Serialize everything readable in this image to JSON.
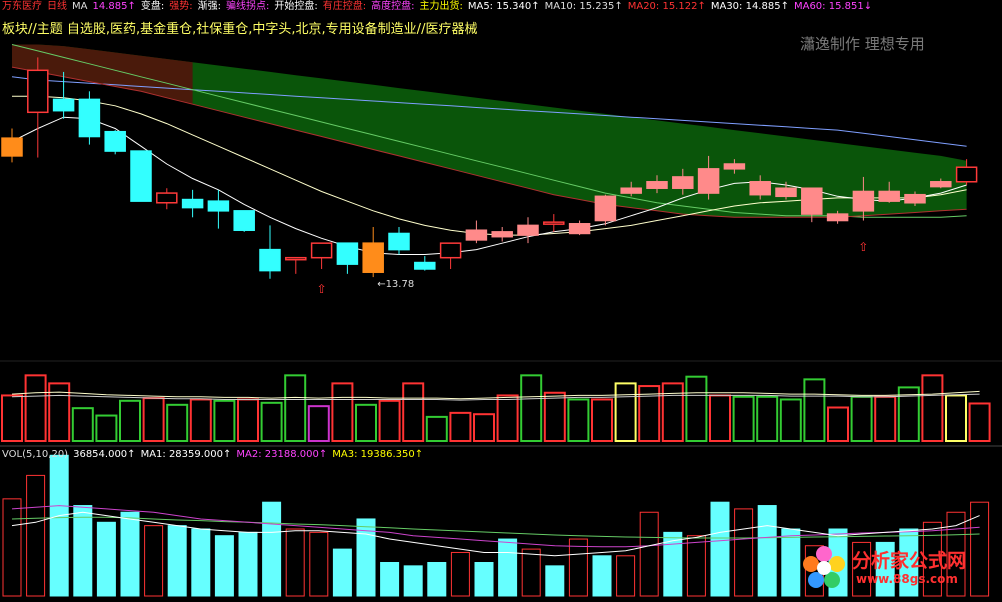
{
  "header": {
    "items": [
      {
        "text": "万东医疗",
        "color": "#ff3333"
      },
      {
        "text": "日线",
        "color": "#ff3333"
      },
      {
        "text": "MA",
        "color": "#dddddd"
      },
      {
        "text": "14.885↑",
        "color": "#ff44ff"
      },
      {
        "text": "变盘:",
        "color": "#ffffff"
      },
      {
        "text": "强势:",
        "color": "#ff3333"
      },
      {
        "text": "渐强:",
        "color": "#ffffff"
      },
      {
        "text": "骗线拐点:",
        "color": "#ff44ff"
      },
      {
        "text": "开始控盘:",
        "color": "#ffffff"
      },
      {
        "text": "有庄控盘:",
        "color": "#ff3333"
      },
      {
        "text": "高度控盘:",
        "color": "#ff44ff"
      },
      {
        "text": "主力出货:",
        "color": "#ffff00"
      },
      {
        "text": "MA5: 15.340↑",
        "color": "#ffffff"
      },
      {
        "text": "MA10: 15.235↑",
        "color": "#dddddd"
      },
      {
        "text": "MA20: 15.122↑",
        "color": "#ff3333"
      },
      {
        "text": "MA30: 14.885↑",
        "color": "#ffffff"
      },
      {
        "text": "MA60: 15.851↓",
        "color": "#ff44ff"
      }
    ],
    "block_text": "板块//主题 自选股,医药,基金重仓,社保重仓,中字头,北京,专用设备制造业//医疗器械"
  },
  "watermark": "瀟逸制作 理想专用",
  "volume_header": {
    "items": [
      {
        "text": "VOL(5,10,20)",
        "color": "#dddddd"
      },
      {
        "text": "36854.000↑",
        "color": "#ffffff"
      },
      {
        "text": "MA1: 28359.000↑",
        "color": "#ffffff"
      },
      {
        "text": "MA2: 23188.000↑",
        "color": "#ff44ff"
      },
      {
        "text": "MA3: 19386.350↑",
        "color": "#ffff00"
      }
    ]
  },
  "logo": {
    "title": "分析家公式网",
    "url": "www.88gs.com"
  },
  "colors": {
    "up": "#ff3a3a",
    "up_fill": "#ff8a8a",
    "down": "#33ffff",
    "ma5": "#ffffff",
    "ma10": "#ffffcc",
    "ma20": "#b03030",
    "ma30": "#66cc66",
    "ma60": "#7f9fff",
    "band": "#0b5a0b",
    "band_red": "#5a0b0b",
    "orange": "#ff8c1a"
  },
  "chart_data": [
    {
      "type": "candlestick",
      "title": "万东医疗 日线",
      "ylim": [
        12.6,
        20.4
      ],
      "low_label": "13.78",
      "candles": [
        {
          "o": 16.75,
          "c": 17.3,
          "h": 17.6,
          "l": 16.55,
          "k": "orange"
        },
        {
          "o": 18.1,
          "c": 19.4,
          "h": 19.8,
          "l": 16.7,
          "k": "up"
        },
        {
          "o": 18.5,
          "c": 18.15,
          "h": 19.35,
          "l": 17.9,
          "k": "down"
        },
        {
          "o": 18.5,
          "c": 17.35,
          "h": 18.75,
          "l": 17.1,
          "k": "down"
        },
        {
          "o": 17.5,
          "c": 16.9,
          "h": 17.55,
          "l": 16.8,
          "k": "down"
        },
        {
          "o": 16.9,
          "c": 15.35,
          "h": 16.9,
          "l": 15.35,
          "k": "down"
        },
        {
          "o": 15.3,
          "c": 15.6,
          "h": 15.75,
          "l": 15.1,
          "k": "up"
        },
        {
          "o": 15.4,
          "c": 15.15,
          "h": 15.7,
          "l": 14.85,
          "k": "down"
        },
        {
          "o": 15.35,
          "c": 15.05,
          "h": 15.7,
          "l": 14.5,
          "k": "down"
        },
        {
          "o": 15.05,
          "c": 14.45,
          "h": 15.05,
          "l": 14.4,
          "k": "down"
        },
        {
          "o": 13.85,
          "c": 13.2,
          "h": 14.6,
          "l": 12.95,
          "k": "down"
        },
        {
          "o": 13.6,
          "c": 13.55,
          "h": 13.6,
          "l": 13.1,
          "k": "up"
        },
        {
          "o": 13.6,
          "c": 14.05,
          "h": 14.05,
          "l": 13.25,
          "k": "up"
        },
        {
          "o": 14.05,
          "c": 13.4,
          "h": 14.05,
          "l": 13.1,
          "k": "down"
        },
        {
          "o": 14.05,
          "c": 13.15,
          "h": 14.55,
          "l": 13.0,
          "k": "orange"
        },
        {
          "o": 14.35,
          "c": 13.85,
          "h": 14.55,
          "l": 13.7,
          "k": "down"
        },
        {
          "o": 13.45,
          "c": 13.25,
          "h": 13.65,
          "l": 13.2,
          "k": "down"
        },
        {
          "o": 13.6,
          "c": 14.05,
          "h": 14.05,
          "l": 13.25,
          "k": "up"
        },
        {
          "o": 14.15,
          "c": 14.45,
          "h": 14.75,
          "l": 14.05,
          "k": "up_fill"
        },
        {
          "o": 14.25,
          "c": 14.4,
          "h": 14.55,
          "l": 14.1,
          "k": "up_fill"
        },
        {
          "o": 14.3,
          "c": 14.6,
          "h": 14.85,
          "l": 14.05,
          "k": "up_fill"
        },
        {
          "o": 14.65,
          "c": 14.7,
          "h": 14.95,
          "l": 14.4,
          "k": "up"
        },
        {
          "o": 14.35,
          "c": 14.65,
          "h": 14.75,
          "l": 14.3,
          "k": "up_fill"
        },
        {
          "o": 14.75,
          "c": 15.5,
          "h": 15.55,
          "l": 14.6,
          "k": "up_fill"
        },
        {
          "o": 15.6,
          "c": 15.75,
          "h": 15.95,
          "l": 15.5,
          "k": "up_fill"
        },
        {
          "o": 15.75,
          "c": 15.95,
          "h": 16.15,
          "l": 15.6,
          "k": "up_fill"
        },
        {
          "o": 15.75,
          "c": 16.1,
          "h": 16.35,
          "l": 15.55,
          "k": "up_fill"
        },
        {
          "o": 15.6,
          "c": 16.35,
          "h": 16.75,
          "l": 15.4,
          "k": "up_fill"
        },
        {
          "o": 16.35,
          "c": 16.5,
          "h": 16.65,
          "l": 16.2,
          "k": "up_fill"
        },
        {
          "o": 15.55,
          "c": 15.95,
          "h": 16.15,
          "l": 15.4,
          "k": "up_fill"
        },
        {
          "o": 15.5,
          "c": 15.75,
          "h": 15.95,
          "l": 15.4,
          "k": "up_fill"
        },
        {
          "o": 14.95,
          "c": 15.75,
          "h": 15.75,
          "l": 14.7,
          "k": "up_fill"
        },
        {
          "o": 14.95,
          "c": 14.75,
          "h": 15.05,
          "l": 14.65,
          "k": "up_fill"
        },
        {
          "o": 15.05,
          "c": 15.65,
          "h": 16.1,
          "l": 14.75,
          "k": "up_fill"
        },
        {
          "o": 15.35,
          "c": 15.65,
          "h": 15.95,
          "l": 15.3,
          "k": "up_fill"
        },
        {
          "o": 15.3,
          "c": 15.55,
          "h": 15.65,
          "l": 15.2,
          "k": "up_fill"
        },
        {
          "o": 15.8,
          "c": 15.95,
          "h": 16.05,
          "l": 15.75,
          "k": "up_fill"
        },
        {
          "o": 15.95,
          "c": 16.4,
          "h": 16.65,
          "l": 15.85,
          "k": "up"
        }
      ],
      "ma5": [
        17.2,
        17.6,
        17.95,
        17.9,
        17.6,
        17.05,
        16.5,
        16.05,
        15.7,
        15.25,
        14.85,
        14.5,
        14.2,
        13.95,
        13.75,
        13.7,
        13.7,
        13.75,
        13.85,
        14.05,
        14.25,
        14.4,
        14.5,
        14.65,
        14.9,
        15.15,
        15.45,
        15.7,
        15.9,
        15.95,
        15.85,
        15.7,
        15.5,
        15.4,
        15.35,
        15.45,
        15.6,
        15.85
      ],
      "ma10": [
        18.6,
        18.6,
        18.55,
        18.45,
        18.3,
        18.05,
        17.75,
        17.4,
        17.05,
        16.7,
        16.35,
        16.0,
        15.65,
        15.35,
        15.05,
        14.8,
        14.6,
        14.45,
        14.35,
        14.3,
        14.3,
        14.35,
        14.4,
        14.5,
        14.6,
        14.75,
        14.9,
        15.05,
        15.2,
        15.3,
        15.35,
        15.4,
        15.45,
        15.45,
        15.45,
        15.45,
        15.55,
        15.7
      ],
      "ma20": [
        19.5,
        19.35,
        19.2,
        19.05,
        18.9,
        18.75,
        18.55,
        18.35,
        18.15,
        17.95,
        17.75,
        17.55,
        17.35,
        17.15,
        16.95,
        16.75,
        16.55,
        16.35,
        16.15,
        15.95,
        15.75,
        15.55,
        15.4,
        15.25,
        15.15,
        15.05,
        14.95,
        14.9,
        14.85,
        14.85,
        14.85,
        14.85,
        14.85,
        14.9,
        14.95,
        15.0,
        15.05,
        15.1
      ],
      "ma30": [
        20.2,
        20.0,
        19.8,
        19.6,
        19.4,
        19.2,
        19.0,
        18.8,
        18.6,
        18.4,
        18.2,
        18.0,
        17.8,
        17.6,
        17.4,
        17.2,
        17.0,
        16.8,
        16.6,
        16.4,
        16.2,
        16.0,
        15.8,
        15.6,
        15.45,
        15.3,
        15.2,
        15.1,
        15.0,
        14.95,
        14.9,
        14.9,
        14.9,
        14.85,
        14.85,
        14.85,
        14.85,
        14.9
      ],
      "ma60": [
        19.2,
        19.1,
        19.05,
        19.0,
        18.95,
        18.9,
        18.85,
        18.8,
        18.75,
        18.7,
        18.65,
        18.6,
        18.55,
        18.5,
        18.45,
        18.4,
        18.35,
        18.3,
        18.25,
        18.2,
        18.15,
        18.1,
        18.05,
        18.0,
        17.95,
        17.9,
        17.85,
        17.8,
        17.75,
        17.7,
        17.65,
        17.6,
        17.55,
        17.45,
        17.35,
        17.25,
        17.15,
        17.05
      ],
      "upper_band": [
        20.2,
        20.2,
        20.15,
        20.05,
        19.95,
        19.85,
        19.75,
        19.65,
        19.55,
        19.45,
        19.35,
        19.25,
        19.15,
        19.05,
        18.95,
        18.85,
        18.75,
        18.65,
        18.55,
        18.45,
        18.35,
        18.25,
        18.15,
        18.05,
        17.95,
        17.85,
        17.75,
        17.65,
        17.55,
        17.45,
        17.35,
        17.25,
        17.15,
        17.05,
        16.95,
        16.85,
        16.75,
        16.6
      ]
    },
    {
      "type": "bar",
      "title": "signal strip",
      "ylim": [
        0,
        100
      ],
      "values": [
        68,
        98,
        86,
        49,
        38,
        60,
        64,
        54,
        62,
        60,
        62,
        57,
        98,
        52,
        86,
        54,
        60,
        86,
        36,
        42,
        40,
        68,
        98,
        72,
        62,
        62,
        86,
        82,
        86,
        96,
        68,
        66,
        66,
        62,
        92,
        50,
        66,
        66,
        80,
        98,
        68,
        56
      ],
      "colors": [
        "r",
        "r",
        "r",
        "g",
        "g",
        "g",
        "r",
        "g",
        "r",
        "g",
        "r",
        "g",
        "g",
        "m",
        "r",
        "g",
        "r",
        "r",
        "g",
        "r",
        "r",
        "r",
        "g",
        "r",
        "g",
        "r",
        "y",
        "r",
        "r",
        "g",
        "r",
        "g",
        "g",
        "g",
        "g",
        "r",
        "g",
        "r",
        "g",
        "r",
        "y",
        "r",
        "y"
      ],
      "line1": [
        70,
        72,
        73,
        71,
        69,
        68,
        67,
        66,
        66,
        65,
        65,
        64,
        65,
        64,
        65,
        65,
        64,
        64,
        64,
        63,
        64,
        65,
        66,
        67,
        68,
        68,
        69,
        70,
        71,
        72,
        72,
        72,
        71,
        70,
        70,
        69,
        68,
        68,
        69,
        70,
        72,
        74
      ],
      "line2": [
        66,
        67,
        68,
        67,
        66,
        65,
        64,
        63,
        63,
        62,
        62,
        62,
        62,
        62,
        62,
        62,
        62,
        62,
        62,
        61,
        62,
        62,
        63,
        64,
        65,
        65,
        66,
        67,
        68,
        68,
        68,
        68,
        68,
        67,
        67,
        67,
        66,
        66,
        67,
        68,
        69,
        70
      ]
    },
    {
      "type": "bar",
      "title": "VOL(5,10,20)",
      "ylim": [
        0,
        40000
      ],
      "values": [
        29000,
        36000,
        42000,
        27000,
        22000,
        25000,
        21000,
        21000,
        20000,
        18000,
        19000,
        28000,
        20000,
        19000,
        14000,
        23000,
        10000,
        9000,
        10000,
        13000,
        10000,
        17000,
        14000,
        9000,
        17000,
        12000,
        12000,
        25000,
        19000,
        18000,
        28000,
        26000,
        27000,
        20000,
        15000,
        20000,
        16000,
        16000,
        20000,
        22000,
        25000,
        28000
      ],
      "colors": [
        "r",
        "r",
        "c",
        "c",
        "c",
        "c",
        "r",
        "c",
        "c",
        "c",
        "c",
        "c",
        "r",
        "r",
        "c",
        "c",
        "c",
        "c",
        "c",
        "r",
        "c",
        "c",
        "r",
        "c",
        "r",
        "c",
        "r",
        "r",
        "c",
        "r",
        "c",
        "r",
        "c",
        "c",
        "r",
        "c",
        "r",
        "c",
        "c",
        "r",
        "r",
        "r"
      ],
      "ma1": [
        21000,
        22000,
        24000,
        25000,
        24000,
        23000,
        22000,
        21000,
        20000,
        19500,
        19000,
        19000,
        19500,
        19500,
        19000,
        18500,
        17000,
        16000,
        15000,
        14000,
        13000,
        13000,
        12500,
        12000,
        12500,
        13000,
        13500,
        15000,
        16500,
        17500,
        19000,
        20000,
        21000,
        20000,
        19000,
        18000,
        18500,
        19000,
        19500,
        20000,
        21000,
        24000
      ],
      "ma2": [
        26000,
        26500,
        27000,
        26500,
        26000,
        25500,
        25000,
        24000,
        23000,
        22500,
        22000,
        21500,
        21000,
        20500,
        20000,
        19500,
        19000,
        18000,
        17500,
        17000,
        16500,
        16000,
        15500,
        15000,
        14800,
        14700,
        14700,
        15000,
        15500,
        16000,
        16500,
        17000,
        17500,
        18000,
        18200,
        18500,
        18800,
        19000,
        19200,
        19500,
        20000,
        20500
      ],
      "ma3": [
        23000,
        23200,
        23400,
        23500,
        23500,
        23300,
        23000,
        22700,
        22500,
        22200,
        22000,
        21800,
        21500,
        21300,
        21000,
        20700,
        20400,
        20000,
        19700,
        19400,
        19100,
        18800,
        18500,
        18200,
        18000,
        17800,
        17600,
        17500,
        17400,
        17300,
        17300,
        17300,
        17400,
        17500,
        17600,
        17700,
        17800,
        17900,
        18000,
        18100,
        18300,
        18500
      ]
    }
  ]
}
